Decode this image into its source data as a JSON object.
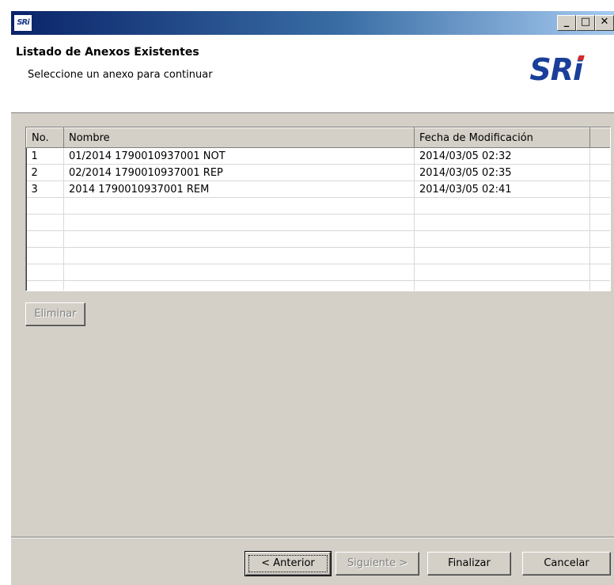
{
  "window": {
    "icon_text": "SRi",
    "buttons": {
      "minimize": "_",
      "maximize": "□",
      "close": "✕"
    }
  },
  "header": {
    "title": "Listado de Anexos Existentes",
    "subtitle": "Seleccione un anexo para continuar",
    "logo": "SRi",
    "logo_accent_color": "#d62828",
    "logo_color": "#1a3f9a"
  },
  "table": {
    "columns": [
      "No.",
      "Nombre",
      "Fecha de Modificación",
      ""
    ],
    "rows": [
      [
        "1",
        "01/2014 1790010937001 NOT",
        "2014/03/05 02:32",
        ""
      ],
      [
        "2",
        "02/2014 1790010937001 REP",
        "2014/03/05 02:35",
        ""
      ],
      [
        "3",
        "2014 1790010937001 REM",
        "2014/03/05 02:41",
        ""
      ],
      [
        "",
        "",
        "",
        ""
      ],
      [
        "",
        "",
        "",
        ""
      ],
      [
        "",
        "",
        "",
        ""
      ],
      [
        "",
        "",
        "",
        ""
      ],
      [
        "",
        "",
        "",
        ""
      ],
      [
        "",
        "",
        "",
        ""
      ]
    ]
  },
  "actions": {
    "eliminar": "Eliminar",
    "anterior": "< Anterior",
    "siguiente": "Siguiente >",
    "finalizar": "Finalizar",
    "cancelar": "Cancelar"
  }
}
